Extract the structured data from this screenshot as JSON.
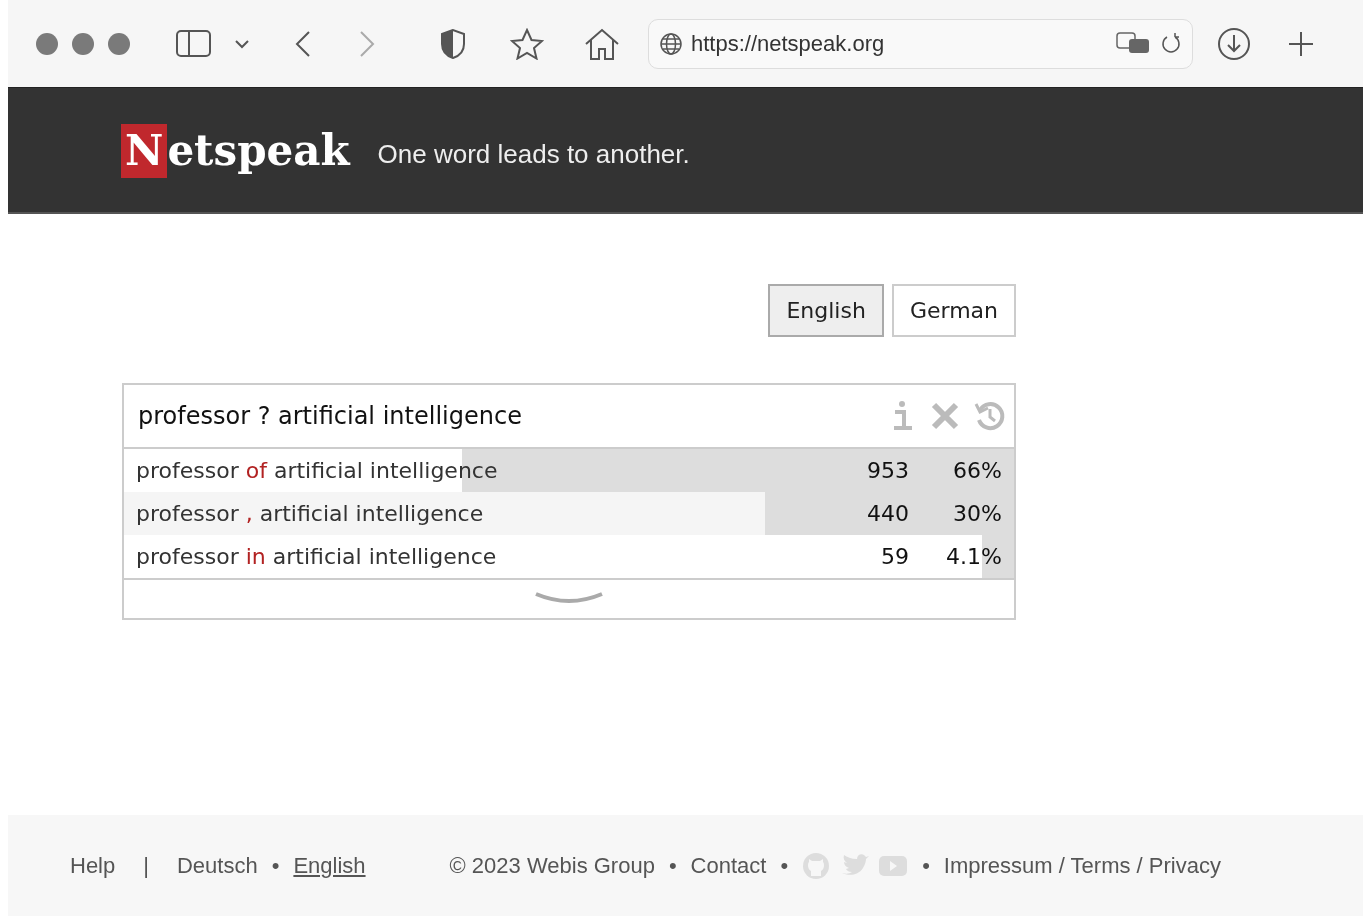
{
  "browser": {
    "url": "https://netspeak.org"
  },
  "header": {
    "logo_initial": "N",
    "logo_rest": "etspeak",
    "tagline": "One word leads to another."
  },
  "languages": [
    {
      "label": "English",
      "selected": true
    },
    {
      "label": "German",
      "selected": false
    }
  ],
  "query": {
    "value": "professor ? artificial intelligence"
  },
  "results": [
    {
      "before": "professor ",
      "word": "of",
      "after": " artificial intelligence",
      "count": "953",
      "share": "66%",
      "level": 0.62
    },
    {
      "before": "professor ",
      "word": ",",
      "after": " artificial intelligence",
      "count": "440",
      "share": "30%",
      "level": 0.28
    },
    {
      "before": "professor ",
      "word": "in",
      "after": " artificial intelligence",
      "count": "59",
      "share": "4.1%",
      "level": 0.036
    }
  ],
  "footer": {
    "help": "Help",
    "separator": "|",
    "languages": [
      {
        "label": "Deutsch",
        "selected": false
      },
      {
        "label": "English",
        "selected": true
      }
    ],
    "copyright": "© 2023 Webis Group",
    "contact": "Contact",
    "legal": "Impressum / Terms / Privacy",
    "bullets": [
      "•",
      "•",
      "•",
      "•"
    ]
  }
}
